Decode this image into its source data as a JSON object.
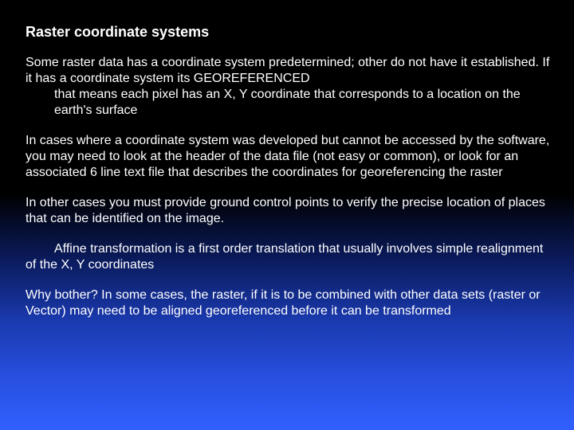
{
  "slide": {
    "title": "Raster coordinate systems",
    "p1_a": "Some raster data has a coordinate system predetermined; other do not have it established.  If it has a coordinate system its GEOREFERENCED",
    "p1_b": "that means each pixel has an X, Y coordinate that corresponds to a location on the earth's surface",
    "p2": "In cases where a coordinate system was developed but cannot be accessed by the software, you may need to look at the header of the data file (not easy or common), or look for an associated 6 line text file that describes the coordinates for georeferencing the raster",
    "p3": "In other cases you must provide ground control points to verify the precise location of places that can be identified on the image.",
    "p4_a": "Affine transformation is a first order translation that usually involves simple realignment of the X, Y coordinates",
    "p5": "Why bother?  In some cases, the raster, if it is to be combined with other data sets (raster or Vector) may need to be aligned georeferenced before it can be transformed"
  }
}
